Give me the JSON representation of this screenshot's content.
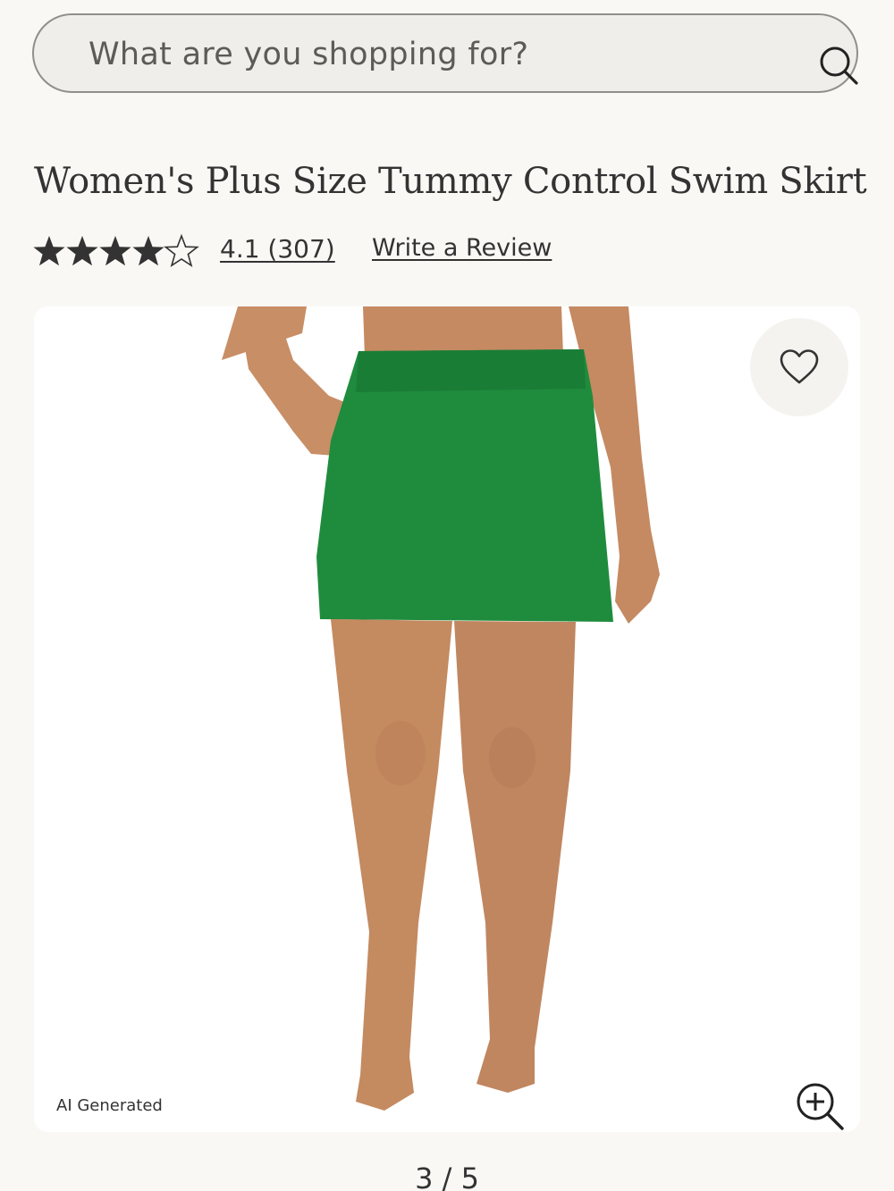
{
  "search": {
    "placeholder": "What are you shopping for?",
    "icon": "search-icon"
  },
  "product": {
    "title": "Women's Plus Size Tummy Control Swim Skirt",
    "rating": 4.1,
    "rating_max": 5,
    "rating_text": "4.1 (307)",
    "review_count": 307,
    "write_review_label": "Write a Review"
  },
  "gallery": {
    "ai_label": "AI Generated",
    "pager_text": "3 / 5",
    "favorite_icon": "heart-icon",
    "zoom_icon": "zoom-in-icon"
  },
  "colors": {
    "background": "#f9f8f5",
    "skirt": "#1f8c3d",
    "text": "#2e2e2e"
  }
}
